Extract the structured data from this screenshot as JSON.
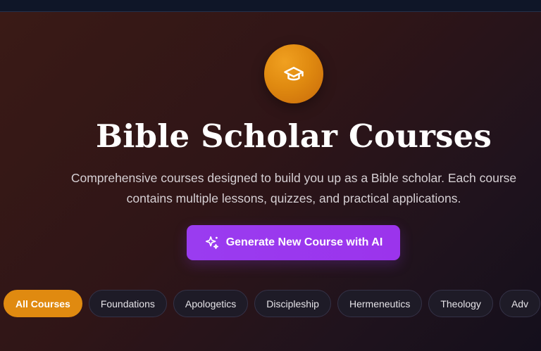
{
  "hero": {
    "icon": "graduation-cap-icon",
    "title": "Bible Scholar Courses",
    "description_line1": "Comprehensive courses designed to build you up as a Bible scholar. Each course",
    "description_line2": "contains multiple lessons, quizzes, and practical applications.",
    "generate_button": "Generate New Course with AI",
    "generate_icon": "sparkles-icon"
  },
  "filters": [
    {
      "label": "All Courses",
      "active": true
    },
    {
      "label": "Foundations"
    },
    {
      "label": "Apologetics"
    },
    {
      "label": "Discipleship"
    },
    {
      "label": "Hermeneutics"
    },
    {
      "label": "Theology"
    },
    {
      "label": "Adv"
    }
  ],
  "colors": {
    "accent": "#e08a10",
    "button": "#9b34ec"
  }
}
